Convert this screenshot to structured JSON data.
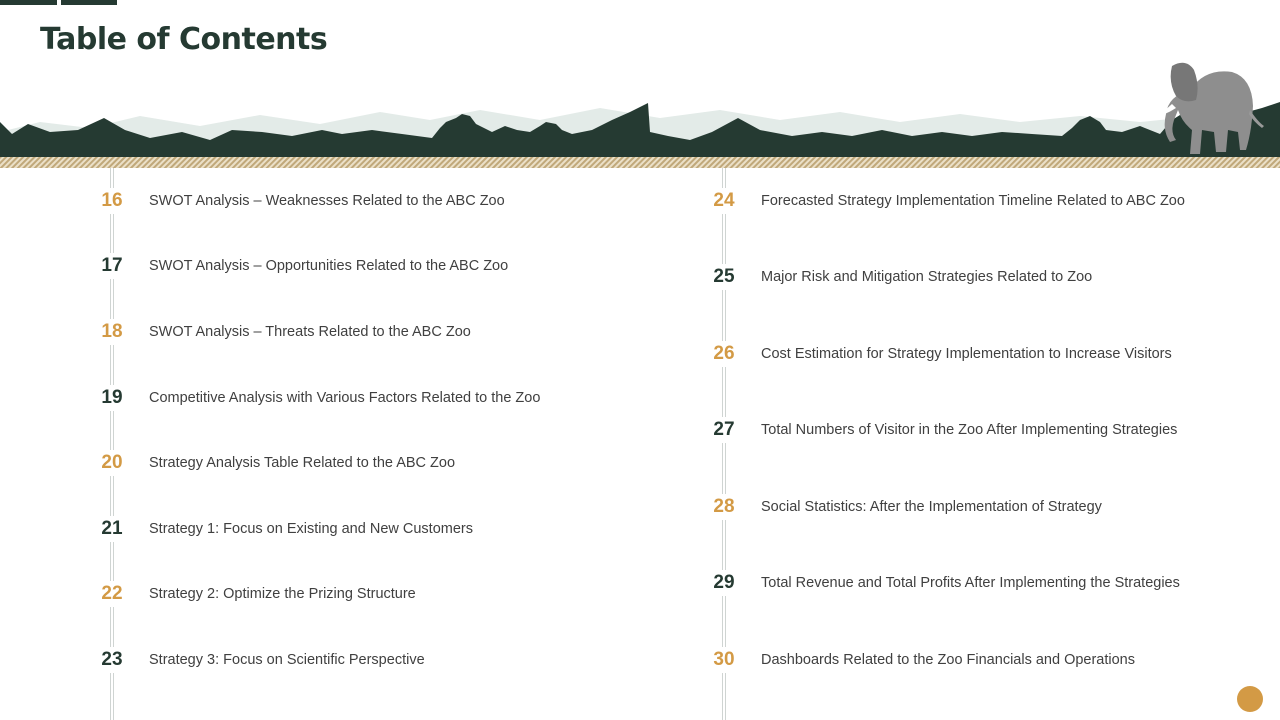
{
  "header": {
    "title": "Table of Contents"
  },
  "colors": {
    "dark": "#253a32",
    "gold": "#d39a45",
    "text": "#404040"
  },
  "banner": {
    "illustration": "savanna-silhouette-with-elephant"
  },
  "toc": {
    "left": [
      {
        "num": "16",
        "label": "SWOT Analysis – Weaknesses Related to the ABC Zoo",
        "color": "gold"
      },
      {
        "num": "17",
        "label": "SWOT Analysis – Opportunities Related to the ABC Zoo",
        "color": "dark"
      },
      {
        "num": "18",
        "label": "SWOT Analysis – Threats Related to the ABC Zoo",
        "color": "gold"
      },
      {
        "num": "19",
        "label": "Competitive Analysis with Various Factors Related to the Zoo",
        "color": "dark"
      },
      {
        "num": "20",
        "label": "Strategy Analysis Table Related to the ABC Zoo",
        "color": "gold"
      },
      {
        "num": "21",
        "label": "Strategy 1: Focus on Existing and New Customers",
        "color": "dark"
      },
      {
        "num": "22",
        "label": "Strategy 2: Optimize the Prizing Structure",
        "color": "gold"
      },
      {
        "num": "23",
        "label": "Strategy 3: Focus on Scientific Perspective",
        "color": "dark"
      }
    ],
    "right": [
      {
        "num": "24",
        "label": "Forecasted Strategy Implementation Timeline Related to ABC Zoo",
        "color": "gold"
      },
      {
        "num": "25",
        "label": "Major Risk and Mitigation  Strategies Related to Zoo",
        "color": "dark"
      },
      {
        "num": "26",
        "label": "Cost Estimation for Strategy Implementation to Increase Visitors",
        "color": "gold"
      },
      {
        "num": "27",
        "label": "Total Numbers of Visitor in the Zoo After Implementing Strategies",
        "color": "dark"
      },
      {
        "num": "28",
        "label": "Social Statistics: After the Implementation of Strategy",
        "color": "gold"
      },
      {
        "num": "29",
        "label": "Total Revenue and Total Profits After Implementing the Strategies",
        "color": "dark"
      },
      {
        "num": "30",
        "label": "Dashboards Related to the Zoo Financials and Operations",
        "color": "gold"
      }
    ]
  }
}
